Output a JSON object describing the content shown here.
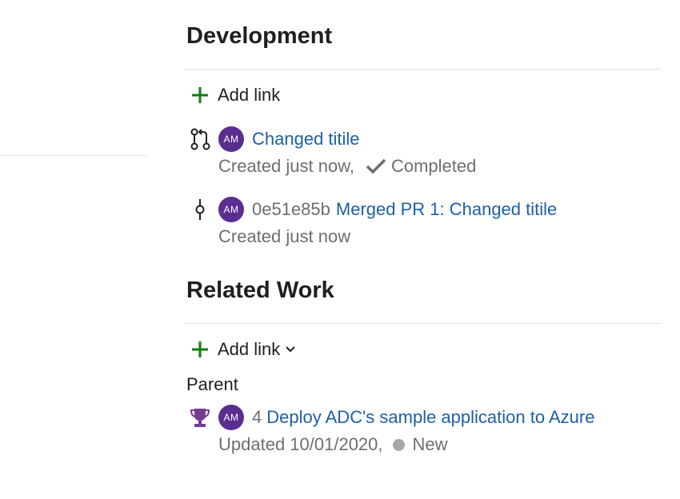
{
  "development": {
    "title": "Development",
    "add_link_label": "Add link",
    "items": [
      {
        "icon": "pull-request-icon",
        "avatar_initials": "AM",
        "link_text": "Changed titile",
        "meta": "Created just now,",
        "status": "Completed"
      },
      {
        "icon": "commit-icon",
        "avatar_initials": "AM",
        "commit_hash": "0e51e85b",
        "link_text": "Merged PR 1: Changed titile",
        "meta": "Created just now"
      }
    ]
  },
  "related_work": {
    "title": "Related Work",
    "add_link_label": "Add link",
    "group_label": "Parent",
    "items": [
      {
        "icon": "trophy-icon",
        "avatar_initials": "AM",
        "id": "4",
        "link_text": "Deploy ADC's sample application to Azure",
        "meta": "Updated 10/01/2020,",
        "state": "New"
      }
    ]
  },
  "colors": {
    "accent_link": "#1e5fa6",
    "avatar_bg": "#5a2d91",
    "add_plus": "#107c10",
    "trophy": "#773b93",
    "state_new": "#a6a6a6"
  }
}
